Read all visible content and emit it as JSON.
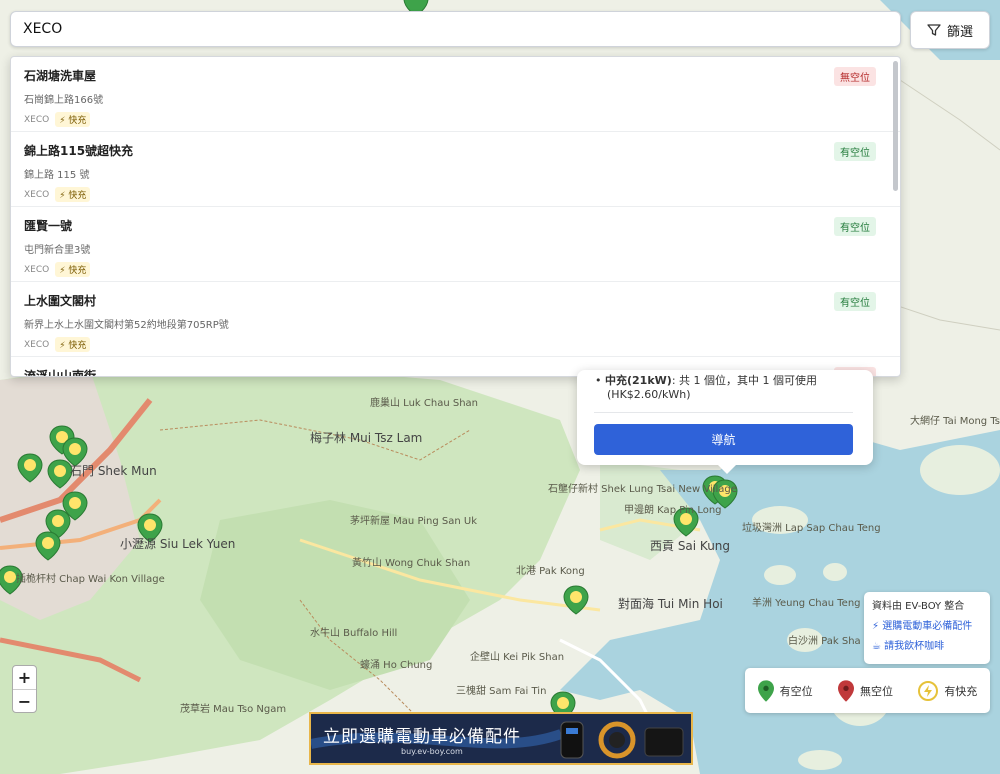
{
  "search": {
    "value": "XECO"
  },
  "filter": {
    "label": "篩選"
  },
  "results": [
    {
      "name": "石湖塘洗車屋",
      "address": "石崗錦上路166號",
      "operator": "XECO",
      "fast": "快充",
      "status": "無空位",
      "available": false
    },
    {
      "name": "錦上路115號超快充",
      "address": "錦上路 115 號",
      "operator": "XECO",
      "fast": "快充",
      "status": "有空位",
      "available": true
    },
    {
      "name": "匯賢一號",
      "address": "屯門新合里3號",
      "operator": "XECO",
      "fast": "快充",
      "status": "有空位",
      "available": true
    },
    {
      "name": "上水圍文閣村",
      "address": "新界上水上水圍文閣村第52約地段第705RP號",
      "operator": "XECO",
      "fast": "快充",
      "status": "有空位",
      "available": true
    },
    {
      "name": "流浮山山南街",
      "address": "",
      "operator": "",
      "fast": "",
      "status": "無空位",
      "available": false
    }
  ],
  "popup": {
    "charger_label": "中充(21kW)",
    "charger_detail": ": 共 1 個位，其中 1 個可使用",
    "price": "(HK$2.60/kWh)",
    "navigate_label": "導航"
  },
  "zoom": {
    "in": "+",
    "out": "−"
  },
  "source": {
    "title": "資料由 EV-BOY 整合",
    "link1": "⚡ 選購電動車必備配件",
    "link2": "☕ 請我飲杯咖啡"
  },
  "legend": {
    "available": "有空位",
    "unavailable": "無空位",
    "fast": "有快充"
  },
  "banner": {
    "title": "立即選購電動車必備配件",
    "url": "buy.ev-boy.com"
  },
  "map_places": {
    "sai_kung": "西貢 Sai Kung",
    "pak_kong": "北港 Pak Kong",
    "tai_mong_tsai": "大網仔 Tai Mong Tsai",
    "tsz_lam": "梅子林 Mui Tsz Lam",
    "shek_mun": "石門 Shek Mun",
    "siu_lek_yuen": "小瀝源 Siu Lek Yuen",
    "tui_min_hoi": "對面海 Tui Min Hoi",
    "kei_pik_shan": "企壁山 Kei Pik Shan",
    "lap_sap": "垃圾灣洲 Lap Sap Chau Teng",
    "yeung_chau": "羊洲 Yeung Chau Teng",
    "kap_pin_long": "甲邊朗 Kap Pin Long",
    "shek_lung_tsai": "石壟仔新村 Shek Lung Tsai New Village",
    "chap_wai_kon": "插桅杆村 Chap Wai Kon Village",
    "luk_chau_shan": "鹿巢山 Luk Chau Shan",
    "mau_ping": "茅坪新屋 Mau Ping San Uk",
    "wong_chuk_shan": "黃竹山 Wong Chuk Shan",
    "buffalo_hill": "水牛山 Buffalo Hill",
    "ho_tung": "蠔涌 Ho Chung",
    "pak_sha": "白沙洲 Pak Sha Chau",
    "sam_fai": "三槐甜 Sam Fai Tin",
    "to_ngam": "茂草岩 Mau Tso Ngam"
  }
}
